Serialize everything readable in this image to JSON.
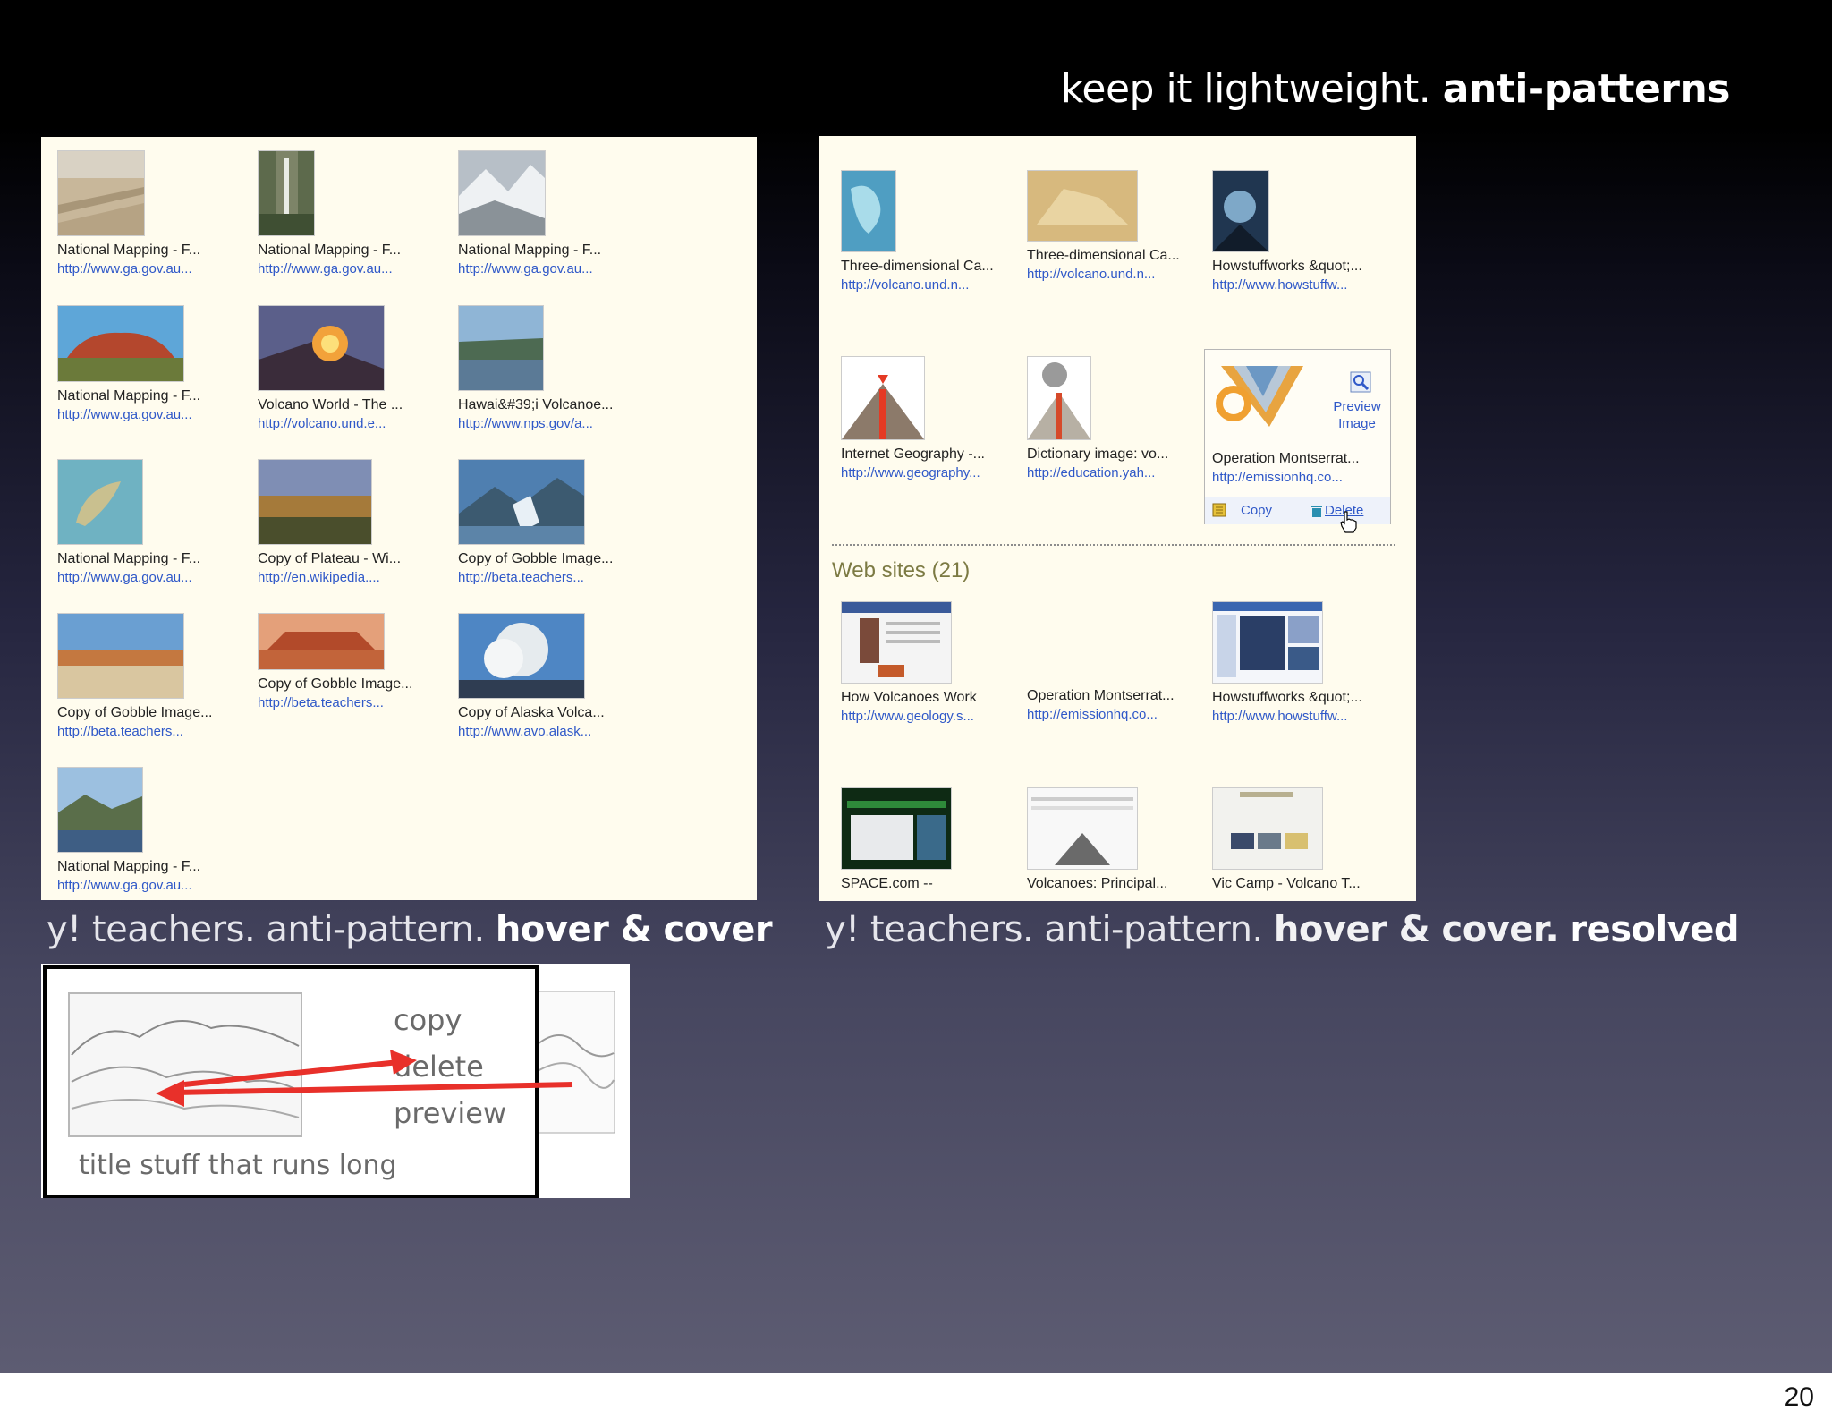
{
  "slide": {
    "title_light": "keep it lightweight.",
    "title_bold": "anti-patterns",
    "page_number": "20"
  },
  "left_panel": {
    "tiles": [
      {
        "title": "National Mapping - F...",
        "url": "http://www.ga.gov.au...",
        "image": "desert-road"
      },
      {
        "title": "National Mapping - F...",
        "url": "http://www.ga.gov.au...",
        "image": "waterfall"
      },
      {
        "title": "National Mapping - F...",
        "url": "http://www.ga.gov.au...",
        "image": "snow-mountains"
      },
      {
        "title": "National Mapping - F...",
        "url": "http://www.ga.gov.au...",
        "image": "uluru"
      },
      {
        "title": "Volcano World - The ...",
        "url": "http://volcano.und.e...",
        "image": "lava"
      },
      {
        "title": "Hawai&#39;i Volcanoe...",
        "url": "http://www.nps.gov/a...",
        "image": "lake"
      },
      {
        "title": "National Mapping - F...",
        "url": "http://www.ga.gov.au...",
        "image": "island"
      },
      {
        "title": "Copy of Plateau - Wi...",
        "url": "http://en.wikipedia....",
        "image": "plateau"
      },
      {
        "title": "Copy of Gobble Image...",
        "url": "http://beta.teachers...",
        "image": "glacier"
      },
      {
        "title": "Copy of Gobble Image...",
        "url": "http://beta.teachers...",
        "image": "desert-beach"
      },
      {
        "title": "Copy of Gobble Image...",
        "url": "http://beta.teachers...",
        "image": "mesa"
      },
      {
        "title": "Copy of Alaska Volca...",
        "url": "http://www.avo.alask...",
        "image": "eruption-cloud"
      },
      {
        "title": "National Mapping - F...",
        "url": "http://www.ga.gov.au...",
        "image": "mountain-lake"
      }
    ]
  },
  "right_panel": {
    "images": [
      {
        "title": "Three-dimensional Ca...",
        "url": "http://volcano.und.n...",
        "image": "relief-blue"
      },
      {
        "title": "Three-dimensional Ca...",
        "url": "http://volcano.und.n...",
        "image": "relief-tan"
      },
      {
        "title": "Howstuffworks &quot;...",
        "url": "http://www.howstuffw...",
        "image": "eruption-dark"
      },
      {
        "title": "Internet Geography -...",
        "url": "http://www.geography...",
        "image": "volcano-cross-section"
      },
      {
        "title": "Dictionary image: vo...",
        "url": "http://education.yah...",
        "image": "volcano-diagram"
      },
      {
        "title": "Operation Montserrat...",
        "url": "http://emissionhq.co...",
        "image": "earth-layers"
      }
    ],
    "hover_actions": {
      "preview_line1": "Preview",
      "preview_line2": "Image",
      "copy": "Copy",
      "delete": "Delete"
    },
    "web_sites_heading": "Web sites (21)",
    "websites": [
      {
        "title": "How Volcanoes Work",
        "url": "http://www.geology.s...",
        "image": "site-geology"
      },
      {
        "title": "Operation Montserrat...",
        "url": "http://emissionhq.co...",
        "image": "blank"
      },
      {
        "title": "Howstuffworks &quot;...",
        "url": "http://www.howstuffw...",
        "image": "site-howstuffworks"
      },
      {
        "title": "SPACE.com --",
        "url": "",
        "image": "site-space"
      },
      {
        "title": "Volcanoes: Principal...",
        "url": "",
        "image": "site-volcanoes"
      },
      {
        "title": "Vic Camp - Volcano T...",
        "url": "",
        "image": "site-viccamp"
      }
    ]
  },
  "captions": {
    "left_light": "y! teachers. anti-pattern.",
    "left_bold": "hover & cover",
    "right_light": "y! teachers. anti-pattern.",
    "right_mid": "hover & cover.",
    "right_bold": "resolved"
  },
  "sketch": {
    "copy": "copy",
    "delete": "delete",
    "preview": "preview",
    "caption": "title stuff that runs long"
  },
  "colors": {
    "panel_bg": "#fffcee",
    "link_blue": "#2f58c8",
    "arrow_red": "#e8302a",
    "section_olive": "#7c7a43"
  }
}
